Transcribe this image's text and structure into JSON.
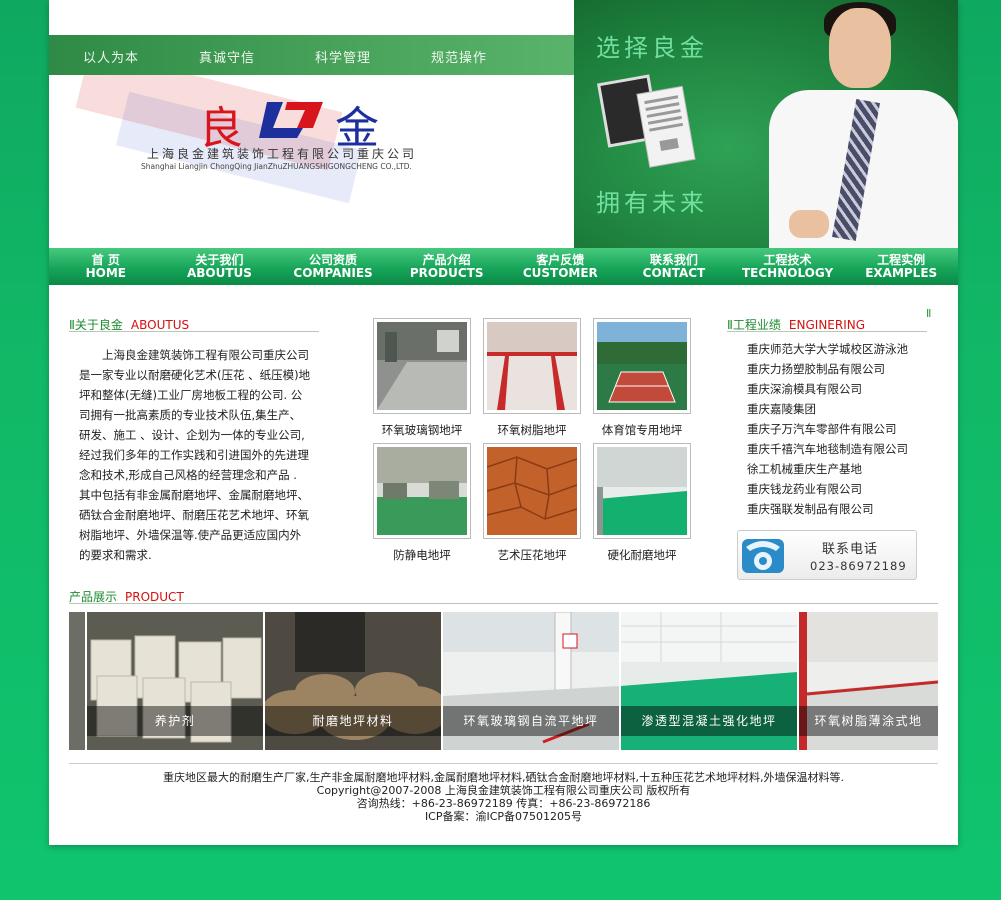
{
  "header": {
    "slogans": [
      "以人为本",
      "真诚守信",
      "科学管理",
      "规范操作"
    ],
    "logo_char_left": "良",
    "logo_char_right": "金",
    "company_cn": "上海良金建筑装饰工程有限公司重庆公司",
    "company_en": "Shanghai Liangjin ChongQing JianZhuZHUANGSHIGONGCHENG CO.,LTD.",
    "banner_text_top": "选择良金",
    "banner_text_bottom": "拥有未来"
  },
  "nav": [
    {
      "cn": "首 页",
      "en": "HOME"
    },
    {
      "cn": "关于我们",
      "en": "ABOUTUS"
    },
    {
      "cn": "公司资质",
      "en": "COMPANIES"
    },
    {
      "cn": "产品介绍",
      "en": "PRODUCTS"
    },
    {
      "cn": "客户反馈",
      "en": "CUSTOMER"
    },
    {
      "cn": "联系我们",
      "en": "CONTACT"
    },
    {
      "cn": "工程技术",
      "en": "TECHNOLOGY"
    },
    {
      "cn": "工程实例",
      "en": "EXAMPLES"
    }
  ],
  "about": {
    "title_cn": "Ⅱ关于良金",
    "title_en": "ABOUTUS",
    "text": "上海良金建筑装饰工程有限公司重庆公司是一家专业以耐磨硬化艺术(压花 、纸压模)地坪和整体(无缝)工业厂房地板工程的公司. 公司拥有一批高素质的专业技术队伍,集生产、研发、施工 、设计、企划为一体的专业公司,经过我们多年的工作实践和引进国外的先进理念和技术,形成自己风格的经营理念和产品 . 其中包括有非金属耐磨地坪、金属耐磨地坪、硒钛合金耐磨地坪、耐磨压花艺术地坪、环氧树脂地坪、外墙保温等.使产品更适应国内外的要求和需求."
  },
  "thumbs": [
    {
      "caption": "环氧玻璃钢地坪",
      "img": "floor-gray"
    },
    {
      "caption": "环氧树脂地坪",
      "img": "floor-red-white"
    },
    {
      "caption": "体育馆专用地坪",
      "img": "tennis-court"
    },
    {
      "caption": "防静电地坪",
      "img": "factory-green"
    },
    {
      "caption": "艺术压花地坪",
      "img": "stamped-orange"
    },
    {
      "caption": "硬化耐磨地坪",
      "img": "green-floor"
    }
  ],
  "engineering": {
    "title_cn": "Ⅱ工程业绩",
    "title_en": "ENGINERING",
    "corner_mark": "Ⅱ",
    "items": [
      "重庆师范大学大学城校区游泳池",
      "重庆力扬塑胶制品有限公司",
      "重庆深渝模具有限公司",
      "重庆嘉陵集团",
      "重庆子万汽车零部件有限公司",
      "重庆千禧汽车地毯制造有限公司",
      "徐工机械重庆生产基地",
      "重庆钱龙药业有限公司",
      "重庆强联发制品有限公司"
    ]
  },
  "contact": {
    "title": "联系电话",
    "number": "023-86972189"
  },
  "products": {
    "title_cn": "产品展示",
    "title_en": "PRODUCT",
    "items": [
      {
        "caption": "养护剂"
      },
      {
        "caption": "耐磨地坪材料"
      },
      {
        "caption": "环氧玻璃钢自流平地坪"
      },
      {
        "caption": "渗透型混凝土强化地坪"
      },
      {
        "caption": "环氧树脂薄涂式地"
      }
    ]
  },
  "footer": {
    "line1": "重庆地区最大的耐磨生产厂家,生产非金属耐磨地坪材料,金属耐磨地坪材料,硒钛合金耐磨地坪材料,十五种压花艺术地坪材料,外墙保温材料等.",
    "line2": "Copyright@2007-2008 上海良金建筑装饰工程有限公司重庆公司 版权所有",
    "line3": "咨询热线：+86-23-86972189 传真：+86-23-86972186",
    "line4": "ICP备案：渝ICP备07501205号"
  },
  "colors": {
    "page_bg": "#11b866",
    "nav_green": "#17a55a",
    "heading_green": "#1d8a2f",
    "heading_red": "#d51010"
  }
}
